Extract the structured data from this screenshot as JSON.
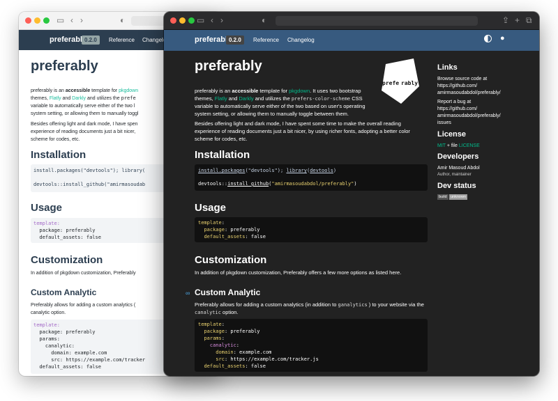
{
  "light_window": {
    "brand": "preferably",
    "version": "0.2.0",
    "nav": [
      "Reference",
      "Changelog"
    ],
    "title": "preferably",
    "intro_lines": [
      "preferably is an accessible template for pkgdown",
      "themes, Flatly and Darkly and utilizes the prefe",
      "variable to automatically serve either of the two l",
      "system setting, or allowing them to manually toggl"
    ],
    "para2_lines": [
      "Besides offering light and dark mode, I have spen",
      "experience of reading documents just a bit nicer,",
      "scheme for codes, etc."
    ],
    "installation_heading": "Installation",
    "install_lines": [
      "install.packages(\"devtools\"); library(",
      "devtools::install_github(\"amirmasoudab"
    ],
    "usage_heading": "Usage",
    "usage_lines": [
      "template:",
      "  package: preferably",
      "  default_assets: false"
    ],
    "customization_heading": "Customization",
    "customization_text": "In addition of pkgdown customization, Preferably",
    "custom_analytic_heading": "Custom Analytic",
    "analytic_text_lines": [
      "Preferably allows for adding a custom analytics (",
      "canalytic option."
    ],
    "analytic_code_lines": [
      "template:",
      "  package: preferably",
      "  params:",
      "    canalytic:",
      "      domain: example.com",
      "      src: https://example.com/tracker",
      "  default_assets: false"
    ]
  },
  "dark_window": {
    "brand": "preferably",
    "version": "0.2.0",
    "nav": [
      "Reference",
      "Changelog"
    ],
    "title": "preferably",
    "logo_text": "prefe rably",
    "intro_lines": [
      "preferably is an accessible template for pkgdown. It uses two bootstrap",
      "themes, Flatly and Darkly and utilizes the prefers-color-scheme CSS",
      "variable to automatically serve either of the two based on user's operating",
      "system setting, or allowing them to manually toggle between them."
    ],
    "para2_lines": [
      "Besides offering light and dark mode, I have spent some time to make the overall reading",
      "experience of reading documents just a bit nicer, by using richer fonts, adopting a better color",
      "scheme for codes, etc."
    ],
    "installation_heading": "Installation",
    "install_lines": [
      "install.packages(\"devtools\"); library(devtools)",
      "devtools::install_github(\"amirmasoudabdol/preferably\")"
    ],
    "usage_heading": "Usage",
    "usage_lines": [
      "template:",
      "  package: preferably",
      "  default_assets: false"
    ],
    "customization_heading": "Customization",
    "customization_text": "In addition of pkgdown customization, Preferably offers a few more options as listed here.",
    "custom_analytic_heading": "Custom Analytic",
    "analytic_text_lines": [
      "Preferably allows for adding a custom analytics (in addition to ganalytics ) to your website via the",
      "canalytic option."
    ],
    "analytic_code_lines": [
      "template:",
      "  package: preferably",
      "  params:",
      "    canalytic:",
      "      domain: example.com",
      "      src: https://example.com/tracker.js",
      "  default_assets: false"
    ],
    "sidebar": {
      "links_heading": "Links",
      "browse_text": "Browse source code at",
      "browse_url_lines": [
        "https://github.com/",
        "amirmasoudabdol/preferably/"
      ],
      "bug_text": "Report a bug at",
      "bug_url_lines": [
        "https://github.com/",
        "amirmasoudabdol/preferably/",
        "issues"
      ],
      "license_heading": "License",
      "license_mit": "MIT",
      "license_plus": " + file ",
      "license_file": "LICENSE",
      "developers_heading": "Developers",
      "developer_name": "Amir Masoud Abdol",
      "developer_role": "Author, maintainer",
      "dev_status_heading": "Dev status",
      "badge_left": "build",
      "badge_right": "unknown"
    }
  },
  "colors": {
    "light_navbar": "#2c3e50",
    "dark_navbar": "#375a7f",
    "link_green": "#00bc8c",
    "dark_bg": "#222222"
  }
}
